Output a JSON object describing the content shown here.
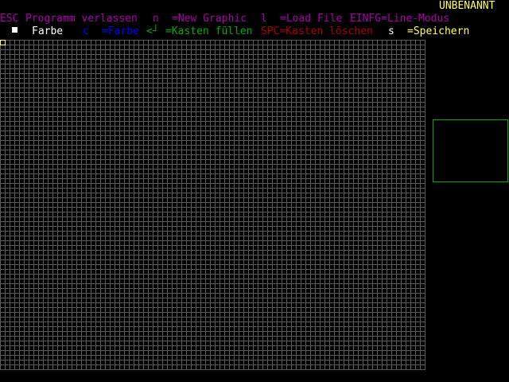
{
  "title": "UNBENANNT",
  "help_line1": {
    "esc_key": "ESC",
    "esc_desc": "Programm verlassen",
    "new_key": "n",
    "new_desc": "=New Graphic",
    "load_key": "l",
    "load_desc": "=Load File",
    "einfg_desc": "EINFG=Line-Modus"
  },
  "help_line2": {
    "color_label": "Farbe",
    "color_key": "c",
    "color_desc": "=Farbe",
    "enter_key": "<┘",
    "enter_desc": "=Kasten füllen",
    "spc_desc": "SPC=Kasten löschen",
    "save_key": "s",
    "save_desc": "=Speichern"
  },
  "colors": {
    "title": "#ffff55",
    "line1": "#aa00aa",
    "color_key": "#0000ff",
    "fill": "#00aa00",
    "clear": "#aa0000",
    "save_key": "#ffffff",
    "save_desc": "#ffff55",
    "grid_lines": "#5a5a5a",
    "preview_border": "#00aa00",
    "current_color": "#ffffff"
  },
  "icons": {
    "current_color_swatch": "current-color-swatch-icon",
    "enter_key": "enter-key-icon"
  }
}
